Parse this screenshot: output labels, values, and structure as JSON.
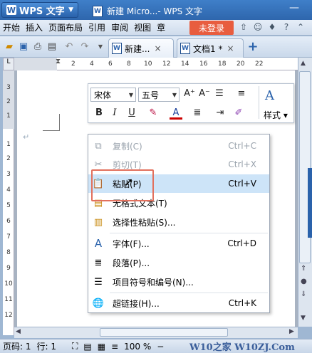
{
  "titlebar": {
    "app_name": "WPS 文字",
    "app_logo": "W",
    "document_title": "新建 Micro...- WPS 文字",
    "minimize": "—"
  },
  "menubar": {
    "items": [
      "开始",
      "插入",
      "页面布局",
      "引用",
      "审阅",
      "视图",
      "章"
    ],
    "login": "未登录"
  },
  "tabs": [
    {
      "label": "新建...",
      "close": "×",
      "icon": "W",
      "active": true
    },
    {
      "label": "文档1 *",
      "close": "×",
      "icon": "W",
      "active": false
    }
  ],
  "add_tab": "+",
  "ruler": {
    "h_ticks": [
      "2",
      "4",
      "6",
      "8",
      "10",
      "12",
      "14",
      "16",
      "18",
      "20",
      "22"
    ],
    "v_ticks": [
      "3",
      "2",
      "1",
      "1",
      "2",
      "3",
      "4",
      "5",
      "6",
      "7",
      "8",
      "9",
      "10",
      "11",
      "12"
    ]
  },
  "minitoolbar": {
    "font": "宋体",
    "size": "五号",
    "style_label": "样式",
    "buttons": [
      "A⁺",
      "A⁻",
      "B",
      "I",
      "U"
    ]
  },
  "context_menu": {
    "items": [
      {
        "label": "复制(C)",
        "shortcut": "Ctrl+C",
        "icon": "copy-icon",
        "disabled": true
      },
      {
        "label": "剪切(T)",
        "shortcut": "Ctrl+X",
        "icon": "cut-icon",
        "disabled": true
      },
      {
        "label": "粘贴(P)",
        "shortcut": "Ctrl+V",
        "icon": "paste-icon",
        "highlighted": true
      },
      {
        "label": "无格式文本(T)",
        "shortcut": "",
        "icon": "paste-plain-icon"
      },
      {
        "label": "选择性粘贴(S)...",
        "shortcut": "",
        "icon": "paste-special-icon"
      },
      {
        "label": "字体(F)...",
        "shortcut": "Ctrl+D",
        "icon": "font-icon"
      },
      {
        "label": "段落(P)...",
        "shortcut": "",
        "icon": "paragraph-icon"
      },
      {
        "label": "项目符号和编号(N)...",
        "shortcut": "",
        "icon": "bullets-icon"
      },
      {
        "label": "超链接(H)...",
        "shortcut": "Ctrl+K",
        "icon": "hyperlink-icon"
      }
    ]
  },
  "statusbar": {
    "page": "页码: 1",
    "row": "行: 1",
    "zoom": "100 %",
    "zoom_minus": "−"
  },
  "watermark": "W10之家 W10ZJ.Com",
  "colors": {
    "accent": "#2a62ab",
    "login": "#e85d3f",
    "highlight": "#cde4f8"
  }
}
